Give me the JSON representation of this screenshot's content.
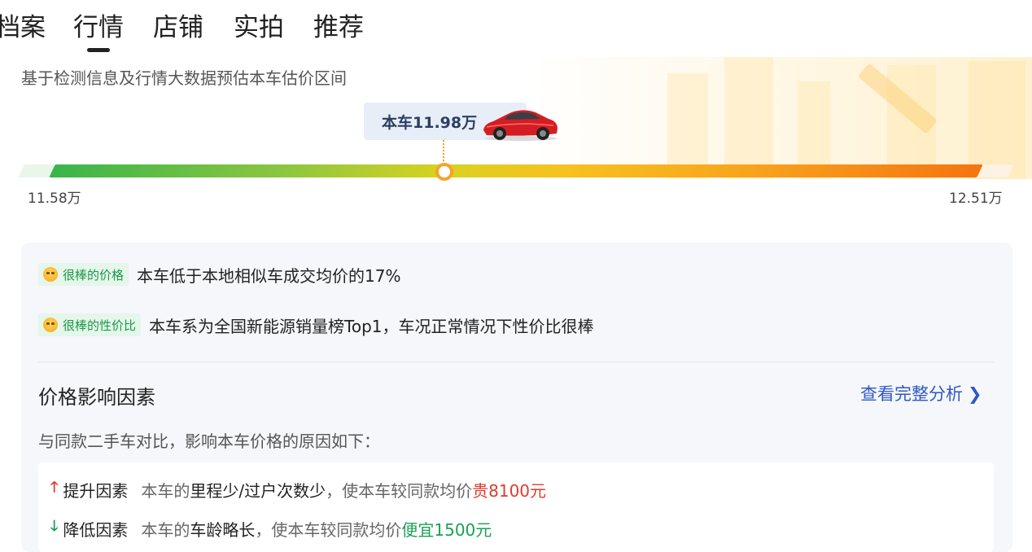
{
  "tabs": [
    {
      "label": "档案"
    },
    {
      "label": "行情",
      "active": true
    },
    {
      "label": "店铺"
    },
    {
      "label": "实拍"
    },
    {
      "label": "推荐"
    }
  ],
  "estimate": {
    "subtitle": "基于检测信息及行情大数据预估本车估价区间",
    "car_price_label": "本车11.98万",
    "min_label": "11.58万",
    "max_label": "12.51万",
    "min_value": 11.58,
    "max_value": 12.51,
    "car_value": 11.98
  },
  "highlights": [
    {
      "tag": "很棒的价格",
      "text": "本车低于本地相似车成交均价的17%"
    },
    {
      "tag": "很棒的性价比",
      "text": "本车系为全国新能源销量榜Top1，车况正常情况下性价比很棒"
    }
  ],
  "factors_section": {
    "title": "价格影响因素",
    "link": "查看完整分析",
    "desc": "与同款二手车对比，影响本车价格的原因如下：",
    "up": {
      "type": "提升因素",
      "prefix": "本车的",
      "key": "里程少/过户次数少",
      "middle": "，使本车较同款均价",
      "result": "贵8100元"
    },
    "down": {
      "type": "降低因素",
      "prefix": "本车的",
      "key": "车龄略长",
      "middle": "，使本车较同款均价",
      "result": "便宜1500元"
    }
  },
  "colors": {
    "accent_blue": "#2f58c7",
    "up_red": "#e03a2e",
    "down_green": "#1aa055",
    "tag_green": "#1b9a4b"
  },
  "icons": {
    "tag_icon": "smiley-emoji-icon",
    "up_icon": "arrow-up-icon",
    "down_icon": "arrow-down-icon",
    "link_icon": "chevron-right-icon",
    "car_icon": "red-car-image"
  }
}
